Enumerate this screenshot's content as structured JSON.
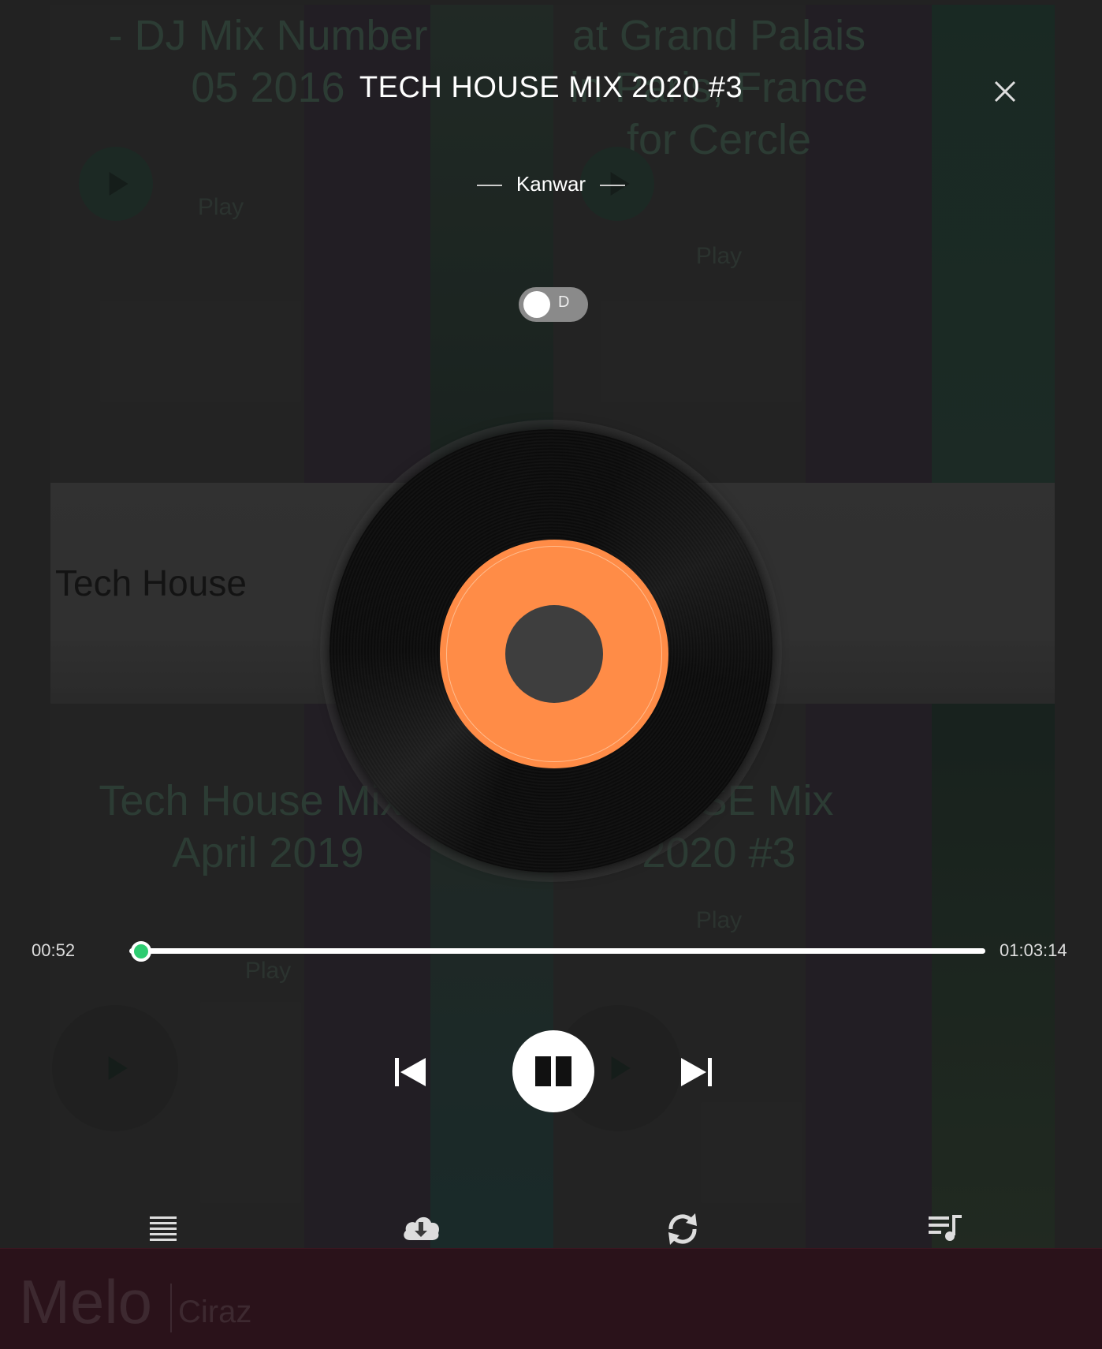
{
  "background": {
    "cards": [
      {
        "title": "- DJ Mix Number 05 2016",
        "play_label": "Play"
      },
      {
        "title": "at Grand Palais in Paris, France for Cercle",
        "play_label": "Play"
      },
      {
        "title": "Tech House Mix – April 2019",
        "play_label": "Play"
      },
      {
        "title": "HOUSE Mix 2020 #3",
        "play_label": "Play"
      }
    ],
    "genre_title": "Tech House",
    "footer": {
      "brand": "Melo",
      "sub": "Ciraz",
      "color": "#3c1220"
    }
  },
  "player": {
    "track_title": "TECH HOUSE MIX 2020 #3",
    "artist": "Kanwar",
    "toggle_label": "D",
    "time_current": "00:52",
    "time_total": "01:03:14",
    "progress_fraction": 0.0137,
    "vinyl_label_color": "#ff8c47",
    "progress_knob_color": "#2ecc71",
    "icons": {
      "close": "close-icon",
      "prev": "skip-previous-icon",
      "pause": "pause-icon",
      "next": "skip-next-icon",
      "list": "list-icon",
      "download": "cloud-download-icon",
      "repeat": "repeat-icon",
      "queue": "playlist-icon"
    }
  }
}
